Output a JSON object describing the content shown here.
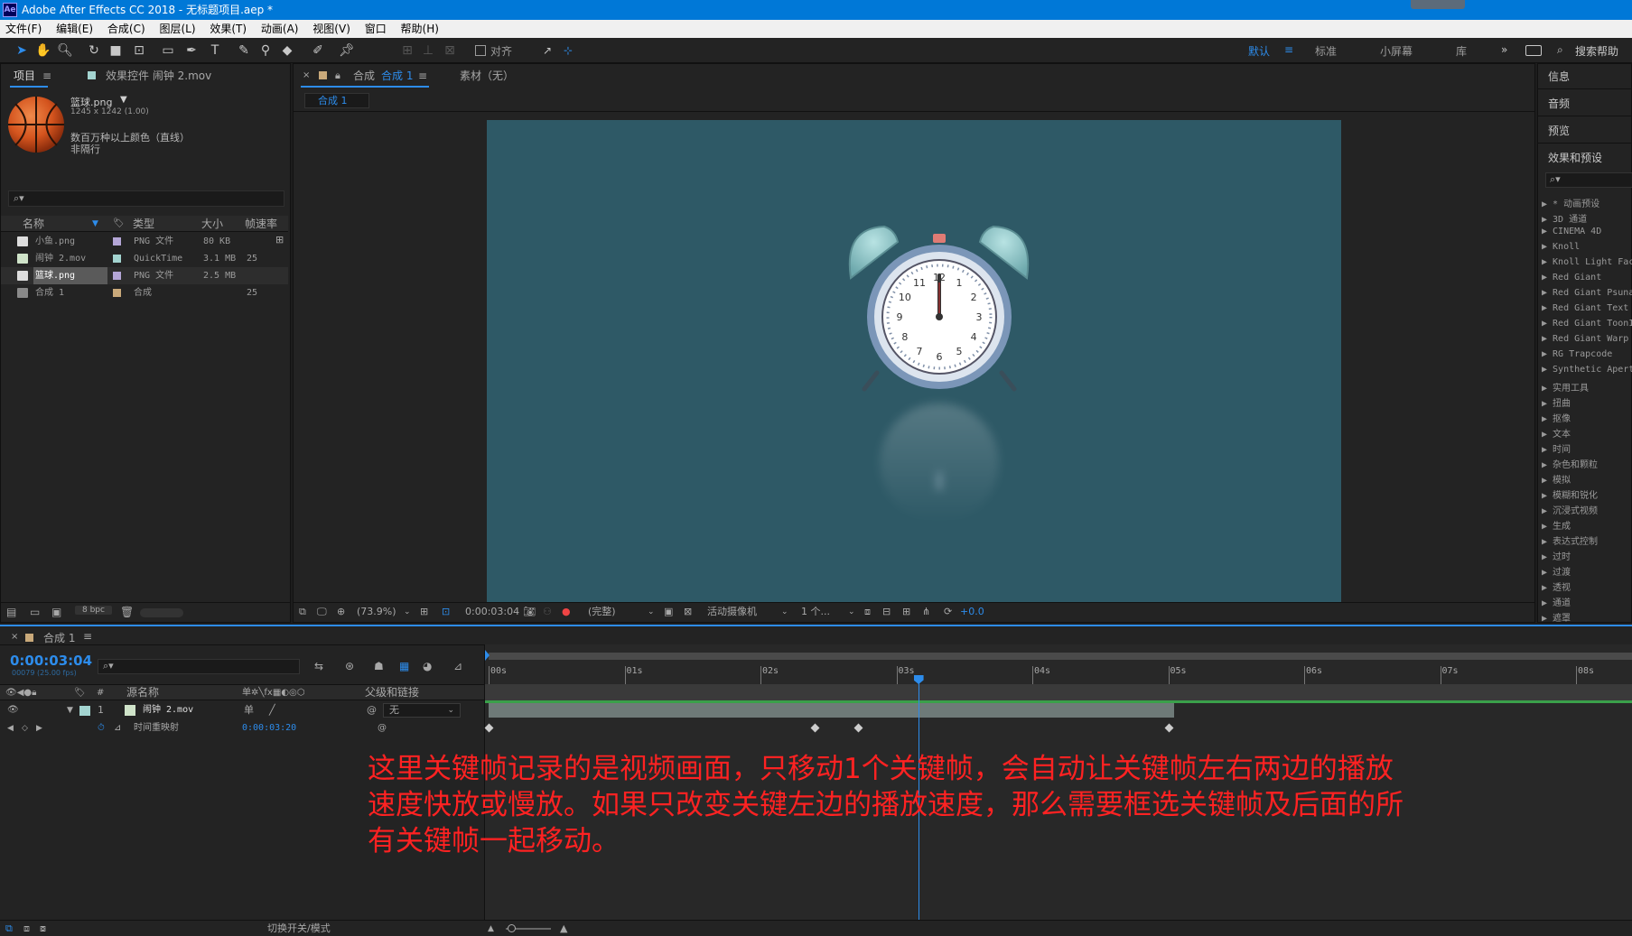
{
  "window": {
    "title": "Adobe After Effects CC 2018 - 无标题项目.aep *",
    "app_icon": "Ae"
  },
  "menu": [
    "文件(F)",
    "编辑(E)",
    "合成(C)",
    "图层(L)",
    "效果(T)",
    "动画(A)",
    "视图(V)",
    "窗口",
    "帮助(H)"
  ],
  "toolbar": {
    "snap_label": "对齐",
    "workspaces": [
      "默认",
      "标准",
      "小屏幕",
      "库"
    ],
    "search_help": "搜索帮助"
  },
  "project": {
    "tab_label": "项目",
    "effect_controls_tab": "效果控件 闹钟 2.mov",
    "preview": {
      "name": "篮球.png",
      "dims": "1245 x 1242 (1.00)",
      "colors": "数百万种以上颜色（直线）",
      "interlace": "非隔行"
    },
    "columns": {
      "name": "名称",
      "type": "类型",
      "size": "大小",
      "fps": "帧速率"
    },
    "files": [
      {
        "name": "小鱼.png",
        "type": "PNG 文件",
        "size": "80 KB",
        "fps": "",
        "label_color": "#b4a6d6"
      },
      {
        "name": "闹钟 2.mov",
        "type": "QuickTime",
        "size": "3.1 MB",
        "fps": "25",
        "label_color": "#a3d4d0"
      },
      {
        "name": "篮球.png",
        "type": "PNG 文件",
        "size": "2.5 MB",
        "fps": "",
        "label_color": "#b4a6d6"
      },
      {
        "name": "合成 1",
        "type": "合成",
        "size": "",
        "fps": "25",
        "label_color": "#c9a97a"
      }
    ],
    "bpc": "8 bpc"
  },
  "composition": {
    "tab_prefix": "合成",
    "tab_name": "合成 1",
    "footage_tab": "素材（无）",
    "breadcrumb": "合成 1",
    "bg_color": "#2e5966",
    "controls": {
      "zoom": "(73.9%)",
      "timecode": "0:00:03:04",
      "resolution": "(完整)",
      "camera": "活动摄像机",
      "views": "1 个...",
      "exposure": "+0.0"
    },
    "clock_numbers": [
      "12",
      "1",
      "2",
      "3",
      "4",
      "5",
      "6",
      "7",
      "8",
      "9",
      "10",
      "11"
    ]
  },
  "right_panel": {
    "sections": [
      "信息",
      "音频",
      "预览",
      "效果和预设"
    ],
    "effects": [
      "* 动画预设",
      "3D 通道",
      "CINEMA 4D",
      "Knoll",
      "Knoll Light Fac",
      "Red Giant",
      "Red Giant Psuna",
      "Red Giant Text",
      "Red Giant ToonI",
      "Red Giant Warp",
      "RG Trapcode",
      "Synthetic Apert",
      "实用工具",
      "扭曲",
      "抠像",
      "文本",
      "时间",
      "杂色和颗粒",
      "模拟",
      "模糊和锐化",
      "沉浸式视频",
      "生成",
      "表达式控制",
      "过时",
      "过渡",
      "透视",
      "通道",
      "遮罩"
    ]
  },
  "timeline": {
    "tab": "合成 1",
    "timecode": "0:00:03:04",
    "frame_info": "00079 (25.00 fps)",
    "columns": {
      "source_name": "源名称",
      "parent": "父级和链接",
      "hash": "#"
    },
    "layer": {
      "index": "1",
      "name": "闹钟 2.mov",
      "parent": "无"
    },
    "property": {
      "name": "时间重映射",
      "value": "0:00:03:20"
    },
    "ruler": [
      "00s",
      "01s",
      "02s",
      "03s",
      "04s",
      "05s",
      "06s",
      "07s",
      "08s"
    ],
    "keyframes_sec": [
      0,
      2.4,
      2.72,
      5.0
    ],
    "playhead_sec": 3.16,
    "layer_end_sec": 5.04,
    "toggle_label": "切换开关/模式"
  },
  "annotation": "这里关键帧记录的是视频画面，只移动1个关键帧，会自动让关键帧左右两边的播放速度快放或慢放。如果只改变关键左边的播放速度，那么需要框选关键帧及后面的所有关键帧一起移动。"
}
